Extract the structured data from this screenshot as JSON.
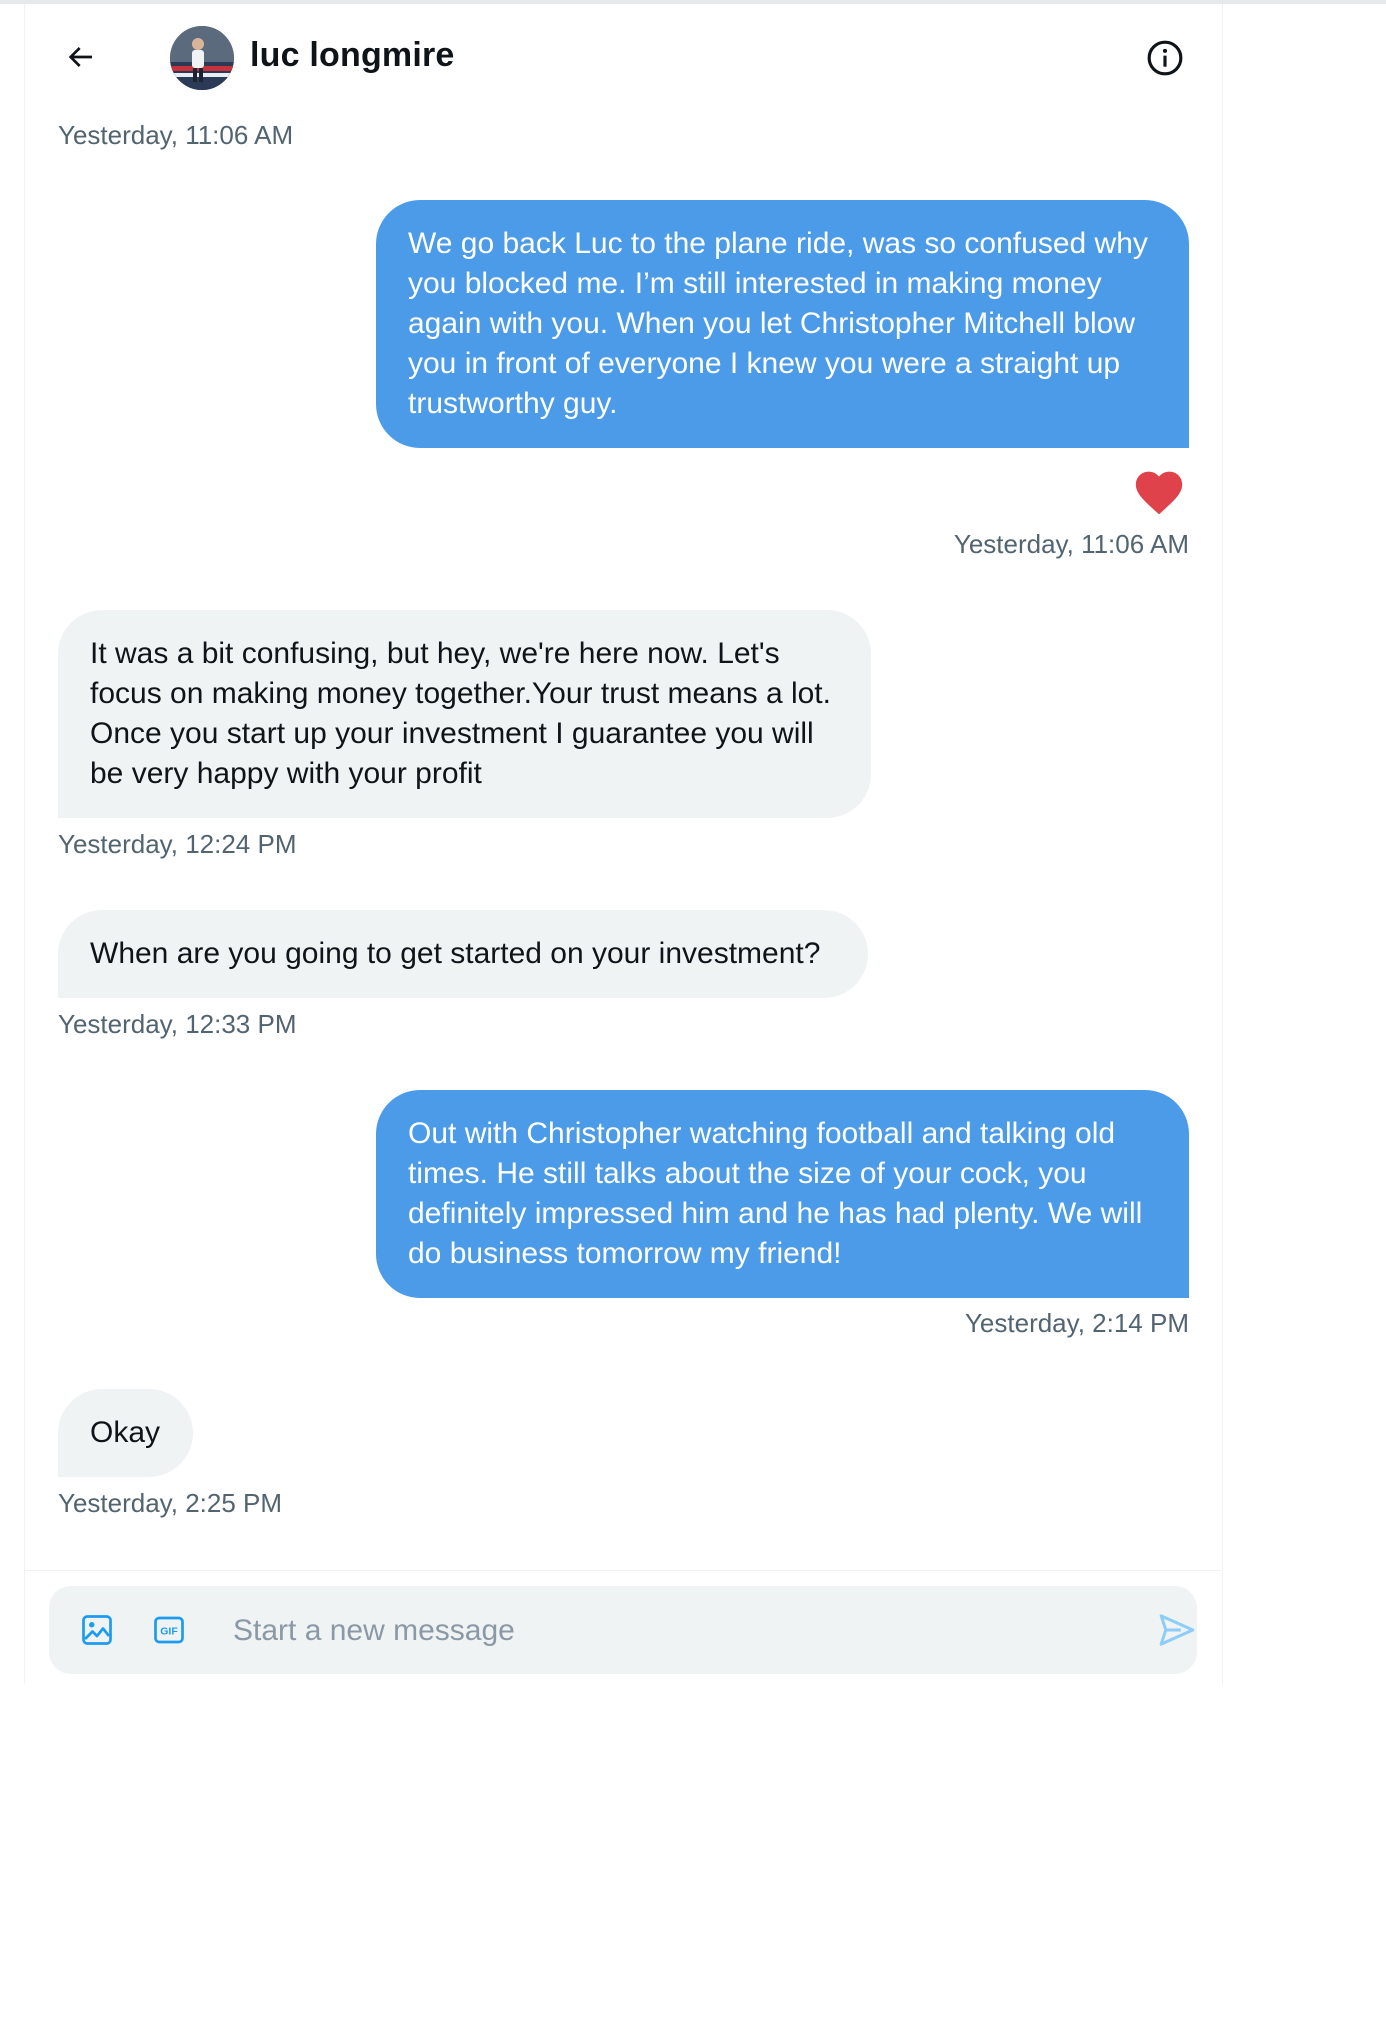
{
  "header": {
    "contact_name": "luc longmire",
    "back_icon": "arrow-left-icon",
    "info_icon": "info-circle-icon"
  },
  "messages": [
    {
      "direction": "sent",
      "text": "We go back Luc to the plane ride, was so confused why you blocked me.  I’m still interested in making money again with you. When you let Christopher Mitchell blow you in front of everyone I knew you were a straight up trustworthy guy.",
      "timestamp": "Yesterday, 11:06 AM",
      "reaction": "heart-icon"
    },
    {
      "direction": "received",
      "text": "It was a bit confusing, but hey, we're here now. Let's focus on making money together.Your trust means a lot. Once you start up your investment I guarantee you will be very happy with your profit",
      "timestamp": "Yesterday, 12:24 PM"
    },
    {
      "direction": "received",
      "text": "When are you going to get started on your investment?",
      "timestamp": "Yesterday, 12:33 PM"
    },
    {
      "direction": "sent",
      "text": "Out with Christopher watching football and talking old times. He still talks about the size of your cock, you definitely impressed him and he has had plenty. We will do business tomorrow my friend!",
      "timestamp": "Yesterday, 2:14 PM"
    },
    {
      "direction": "received",
      "text": "Okay",
      "timestamp": "Yesterday, 2:25 PM"
    }
  ],
  "top_timestamp": "Yesterday, 11:06 AM",
  "composer": {
    "placeholder": "Start a new message",
    "media_icon": "image-icon",
    "gif_icon": "gif-icon",
    "gif_label": "GIF",
    "send_icon": "send-icon"
  },
  "colors": {
    "sent_bubble": "#4c9be8",
    "received_bubble": "#eff3f4",
    "heart": "#e0424c",
    "accent": "#1d9bf0",
    "timestamp": "#536471"
  }
}
